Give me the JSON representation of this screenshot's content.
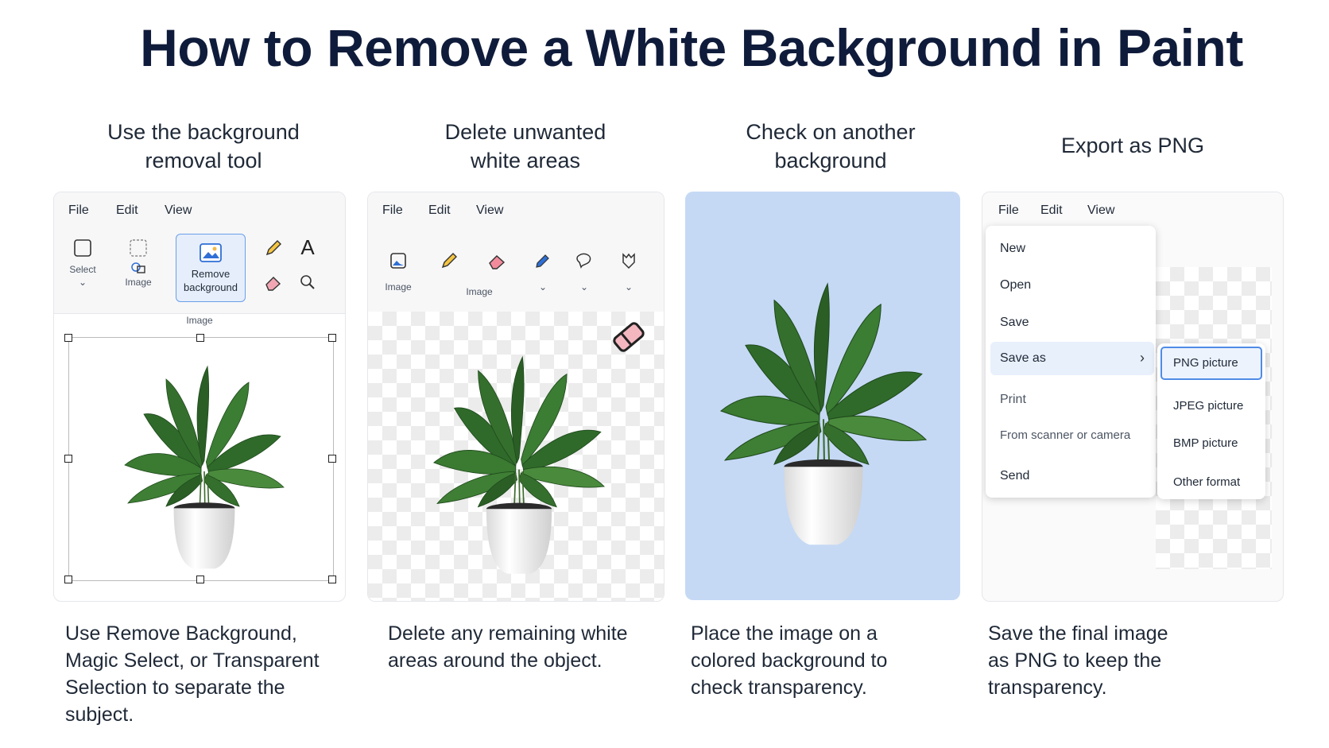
{
  "title": "How to Remove a White Background in Paint",
  "columns": [
    {
      "heading": "Use the background removal tool",
      "description": "Use Remove Background, Magic Select, or Transparent Selection to separate the subject."
    },
    {
      "heading": "Delete unwanted white areas",
      "description": "Delete any remaining white areas around the object."
    },
    {
      "heading": "Check on another background",
      "description": "Place the image on a colored background to check transparency."
    },
    {
      "heading": "Export as PNG",
      "description": "Save the final image as PNG to keep the transparency."
    }
  ],
  "panel1": {
    "menu": {
      "file": "File",
      "edit": "Edit",
      "view": "View"
    },
    "select_label": "Select",
    "image_label": "Image",
    "remove_bg_line1": "Remove",
    "remove_bg_line2": "background",
    "group_label": "Image"
  },
  "panel2": {
    "menu": {
      "file": "File",
      "edit": "Edit",
      "view": "View"
    },
    "image_label_1": "Image",
    "image_label_2": "Image"
  },
  "panel3": {
    "background_color": "#c5d9f5"
  },
  "panel4": {
    "menu": {
      "file": "File",
      "edit": "Edit",
      "view": "View"
    },
    "file_menu": [
      "New",
      "Open",
      "Save",
      "Save as",
      "Print",
      "From scanner or camera",
      "Send"
    ],
    "save_as_submenu": [
      "PNG picture",
      "JPEG picture",
      "BMP picture",
      "Other format"
    ]
  },
  "colors": {
    "title": "#0f1b3a",
    "accent": "#2f6fd6",
    "leaf": "#2f6a2a",
    "pot": "#eeeeee"
  }
}
